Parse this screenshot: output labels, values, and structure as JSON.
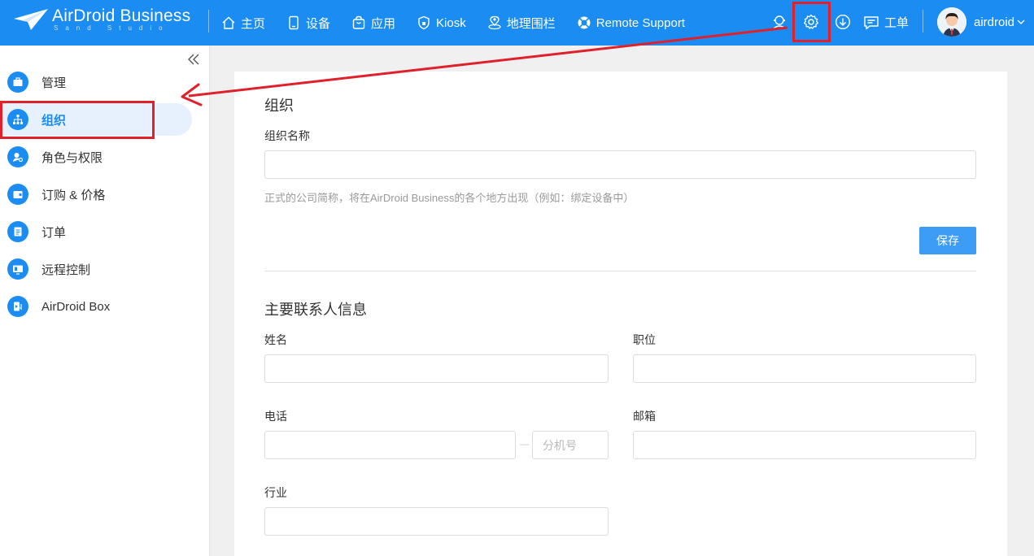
{
  "header": {
    "brand_title": "AirDroid Business",
    "brand_sub": "Sand Studio",
    "nav": [
      {
        "label": "主页",
        "icon": "home-icon"
      },
      {
        "label": "设备",
        "icon": "device-icon"
      },
      {
        "label": "应用",
        "icon": "app-bag-icon"
      },
      {
        "label": "Kiosk",
        "icon": "lock-icon"
      },
      {
        "label": "地理围栏",
        "icon": "geofence-icon"
      },
      {
        "label": "Remote Support",
        "icon": "lifebuoy-icon"
      }
    ],
    "ticket_label": "工单",
    "username": "airdroid"
  },
  "sidebar": {
    "items": [
      {
        "label": "管理",
        "icon": "briefcase-icon"
      },
      {
        "label": "组织",
        "icon": "org-chart-icon",
        "active": true
      },
      {
        "label": "角色与权限",
        "icon": "key-user-icon"
      },
      {
        "label": "订购 & 价格",
        "icon": "wallet-icon"
      },
      {
        "label": "订单",
        "icon": "list-icon"
      },
      {
        "label": "远程控制",
        "icon": "remote-icon"
      },
      {
        "label": "AirDroid Box",
        "icon": "box-icon"
      }
    ]
  },
  "org": {
    "section_title": "组织",
    "name_label": "组织名称",
    "name_value": "",
    "hint": "正式的公司简称，将在AirDroid Business的各个地方出现（例如：绑定设备中）",
    "save_label": "保存"
  },
  "contact": {
    "section_title": "主要联系人信息",
    "name_label": "姓名",
    "title_label": "职位",
    "phone_label": "电话",
    "ext_placeholder": "分机号",
    "email_label": "邮箱",
    "industry_label": "行业"
  },
  "colors": {
    "primary": "#1a8cf2",
    "annotation_red": "#e0202a"
  }
}
